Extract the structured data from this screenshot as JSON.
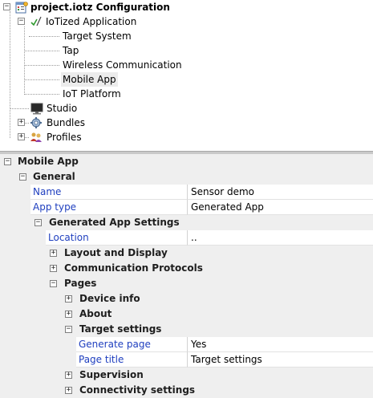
{
  "tree": {
    "root": {
      "label": "project.iotz Configuration",
      "expander": "−"
    },
    "application": {
      "label": "IoTized Application",
      "expander": "−"
    },
    "children": [
      {
        "label": "Target System"
      },
      {
        "label": "Tap"
      },
      {
        "label": "Wireless Communication"
      },
      {
        "label": "Mobile App",
        "selected": true
      },
      {
        "label": "IoT Platform"
      }
    ],
    "studio": {
      "label": "Studio"
    },
    "bundles": {
      "label": "Bundles",
      "expander": "+"
    },
    "profiles": {
      "label": "Profiles",
      "expander": "+"
    }
  },
  "grid": {
    "title": {
      "label": "Mobile App",
      "expander": "−"
    },
    "general": {
      "label": "General",
      "expander": "−"
    },
    "name": {
      "name": "Name",
      "value": "Sensor demo"
    },
    "app_type": {
      "name": "App type",
      "value": "Generated App"
    },
    "generated_settings": {
      "label": "Generated App Settings",
      "expander": "−"
    },
    "location": {
      "name": "Location",
      "value": ".."
    },
    "layout_display": {
      "label": "Layout and Display",
      "expander": "+"
    },
    "comm_protocols": {
      "label": "Communication Protocols",
      "expander": "+"
    },
    "pages": {
      "label": "Pages",
      "expander": "−"
    },
    "device_info": {
      "label": "Device info",
      "expander": "+"
    },
    "about": {
      "label": "About",
      "expander": "+"
    },
    "target_settings": {
      "label": "Target settings",
      "expander": "−"
    },
    "generate_page": {
      "name": "Generate page",
      "value": "Yes"
    },
    "page_title": {
      "name": "Page title",
      "value": "Target settings"
    },
    "supervision": {
      "label": "Supervision",
      "expander": "+"
    },
    "connectivity": {
      "label": "Connectivity settings",
      "expander": "+"
    }
  },
  "colors": {
    "property_name": "#1f3fbf",
    "grid_background": "#efefef",
    "selection": "#ececec"
  }
}
